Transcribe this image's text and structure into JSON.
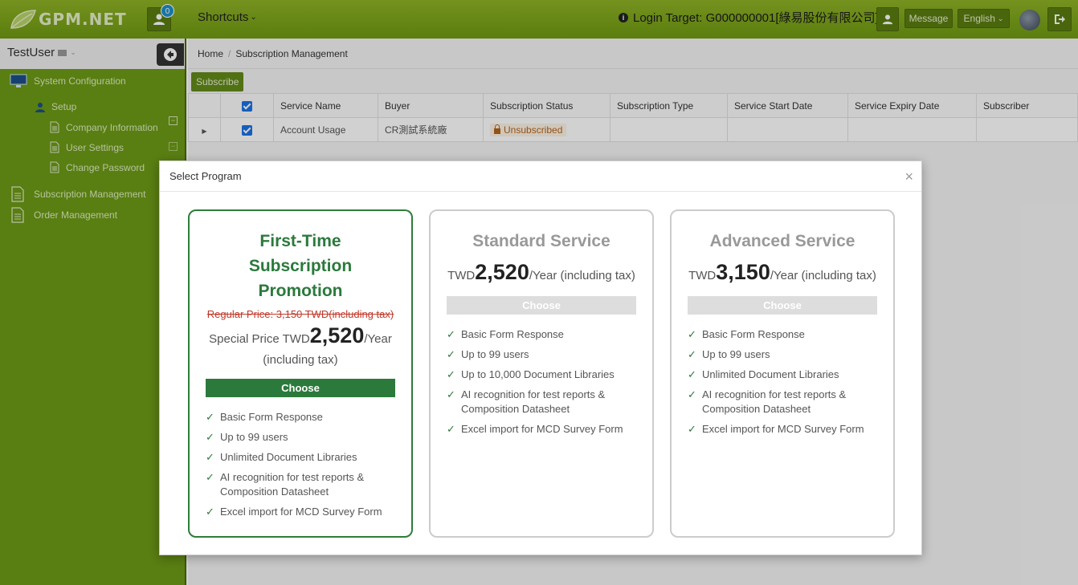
{
  "header": {
    "logo_text": "GPM.NET",
    "notification_count": "0",
    "shortcuts_label": "Shortcuts",
    "login_target": "Login Target: G000000001[綠易股份有限公司]",
    "message_label": "Message",
    "language_label": "English"
  },
  "sidebar": {
    "user_name": "TestUser",
    "items": [
      {
        "label": "System Configuration"
      },
      {
        "label": "Setup"
      },
      {
        "label": "Company Information"
      },
      {
        "label": "User Settings"
      },
      {
        "label": "Change Password"
      },
      {
        "label": "Subscription Management"
      },
      {
        "label": "Order Management"
      }
    ]
  },
  "breadcrumb": {
    "home": "Home",
    "sep": "/",
    "current": "Subscription Management"
  },
  "toolbar": {
    "subscribe_label": "Subscribe"
  },
  "table": {
    "columns": [
      "Service Name",
      "Buyer",
      "Subscription Status",
      "Subscription Type",
      "Service Start Date",
      "Service Expiry Date",
      "Subscriber"
    ],
    "rows": [
      {
        "service_name": "Account Usage",
        "buyer": "CR測試系統廠",
        "status": "Unsubscribed",
        "type": "",
        "start": "",
        "expiry": "",
        "subscriber": ""
      }
    ]
  },
  "modal": {
    "title": "Select Program",
    "close": "×",
    "plans": [
      {
        "title": "First-Time Subscription Promotion",
        "regular_price": "Regular Price: 3,150 TWD(including tax)",
        "price_prefix": "Special Price TWD",
        "amount": "2,520",
        "suffix": "/Year (including tax)",
        "button": "Choose",
        "features": [
          "Basic Form Response",
          "Up to 99 users",
          "Unlimited Document Libraries",
          "AI recognition for test reports & Composition Datasheet",
          "Excel import for MCD Survey Form"
        ]
      },
      {
        "title": "Standard Service",
        "price_prefix": "TWD",
        "amount": "2,520",
        "suffix": "/Year (including tax)",
        "button": "Choose",
        "features": [
          "Basic Form Response",
          "Up to 99 users",
          "Up to 10,000 Document Libraries",
          "AI recognition for test reports & Composition Datasheet",
          "Excel import for MCD Survey Form"
        ]
      },
      {
        "title": "Advanced Service",
        "price_prefix": "TWD",
        "amount": "3,150",
        "suffix": "/Year (including tax)",
        "button": "Choose",
        "features": [
          "Basic Form Response",
          "Up to 99 users",
          "Unlimited Document Libraries",
          "AI recognition for test reports & Composition Datasheet",
          "Excel import for MCD Survey Form"
        ]
      }
    ]
  },
  "colors": {
    "brand_green": "#6d9a16",
    "plan_green": "#2b7a3c",
    "badge_blue": "#1e90c9"
  }
}
